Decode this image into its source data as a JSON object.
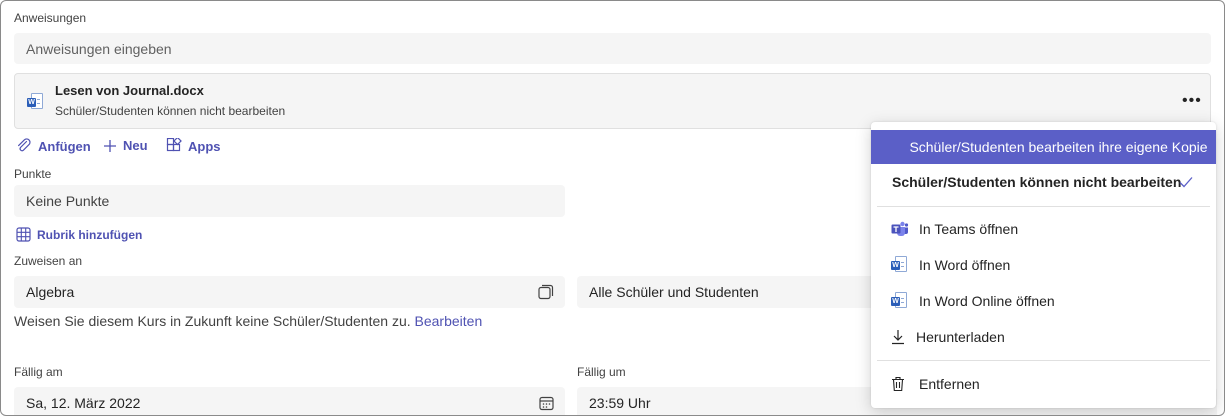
{
  "instructions": {
    "label": "Anweisungen",
    "placeholder": "Anweisungen eingeben"
  },
  "attachment": {
    "title": "Lesen von Journal.docx",
    "subtitle": "Schüler/Studenten können nicht bearbeiten",
    "more_label": "•••"
  },
  "actions": {
    "attach": "Anfügen",
    "new": "Neu",
    "apps": "Apps"
  },
  "points": {
    "label": "Punkte",
    "value": "Keine Punkte"
  },
  "rubric": {
    "label": "Rubrik hinzufügen"
  },
  "assign": {
    "label": "Zuweisen an",
    "class_value": "Algebra",
    "students_value": "Alle Schüler und Studenten",
    "note": "Weisen Sie diesem Kurs in Zukunft keine Schüler/Studenten zu.",
    "edit_link": "Bearbeiten"
  },
  "due": {
    "date_label": "Fällig am",
    "date_value": "Sa, 12. März 2022",
    "time_label": "Fällig um",
    "time_value": "23:59 Uhr"
  },
  "menu": {
    "items": [
      {
        "label": "Schüler/Studenten bearbeiten ihre eigene Kopie",
        "state": "highlighted"
      },
      {
        "label": "Schüler/Studenten können nicht bearbeiten",
        "state": "checked"
      },
      {
        "label": "In Teams öffnen",
        "icon": "teams-icon"
      },
      {
        "label": "In Word öffnen",
        "icon": "word-icon"
      },
      {
        "label": "In Word Online öffnen",
        "icon": "word-icon"
      },
      {
        "label": "Herunterladen",
        "icon": "download-icon"
      },
      {
        "label": "Entfernen",
        "icon": "trash-icon"
      }
    ]
  },
  "colors": {
    "accent": "#5b5fc7",
    "link": "#4f52b2",
    "field_bg": "#f5f5f5"
  }
}
